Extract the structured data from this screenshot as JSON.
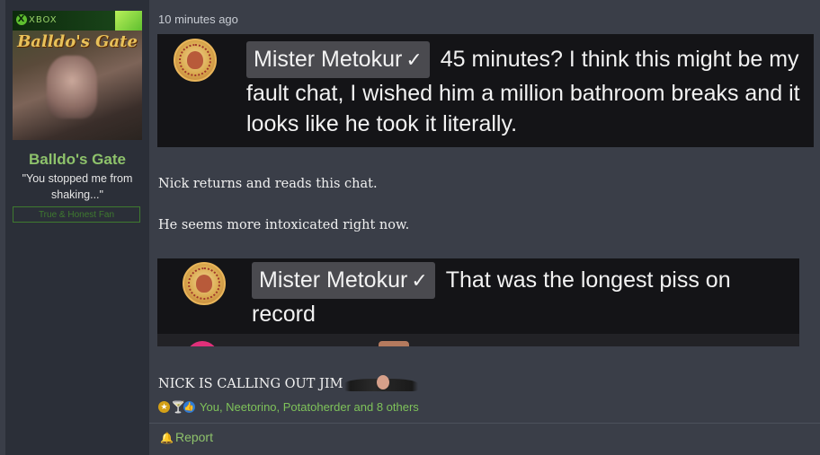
{
  "user": {
    "avatar_badge": "XBOX",
    "avatar_title": "Balldo's Gate",
    "name": "Balldo's Gate",
    "title": "\"You stopped me from shaking...\"",
    "banner": "True & Honest Fan"
  },
  "post": {
    "time": "10 minutes ago",
    "chat1": {
      "name": "Mister Metokur",
      "verified": "✓",
      "message": "45 minutes? I think this might be my fault chat, I wished him a million bathroom breaks and it looks like he took it literally."
    },
    "line1": "Nick returns and reads this chat.",
    "line2": "He seems more intoxicated right now.",
    "chat2": {
      "name": "Mister Metokur",
      "verified": "✓",
      "message": "That was the longest piss on record"
    },
    "line3": "NICK IS CALLING OUT JIM",
    "reactions": "You, Neetorino, Potatoherder and 8 others",
    "report": "Report"
  },
  "colors": {
    "accent": "#8ec26b",
    "background": "#3a3e48",
    "sidebar": "#2b2f38"
  }
}
